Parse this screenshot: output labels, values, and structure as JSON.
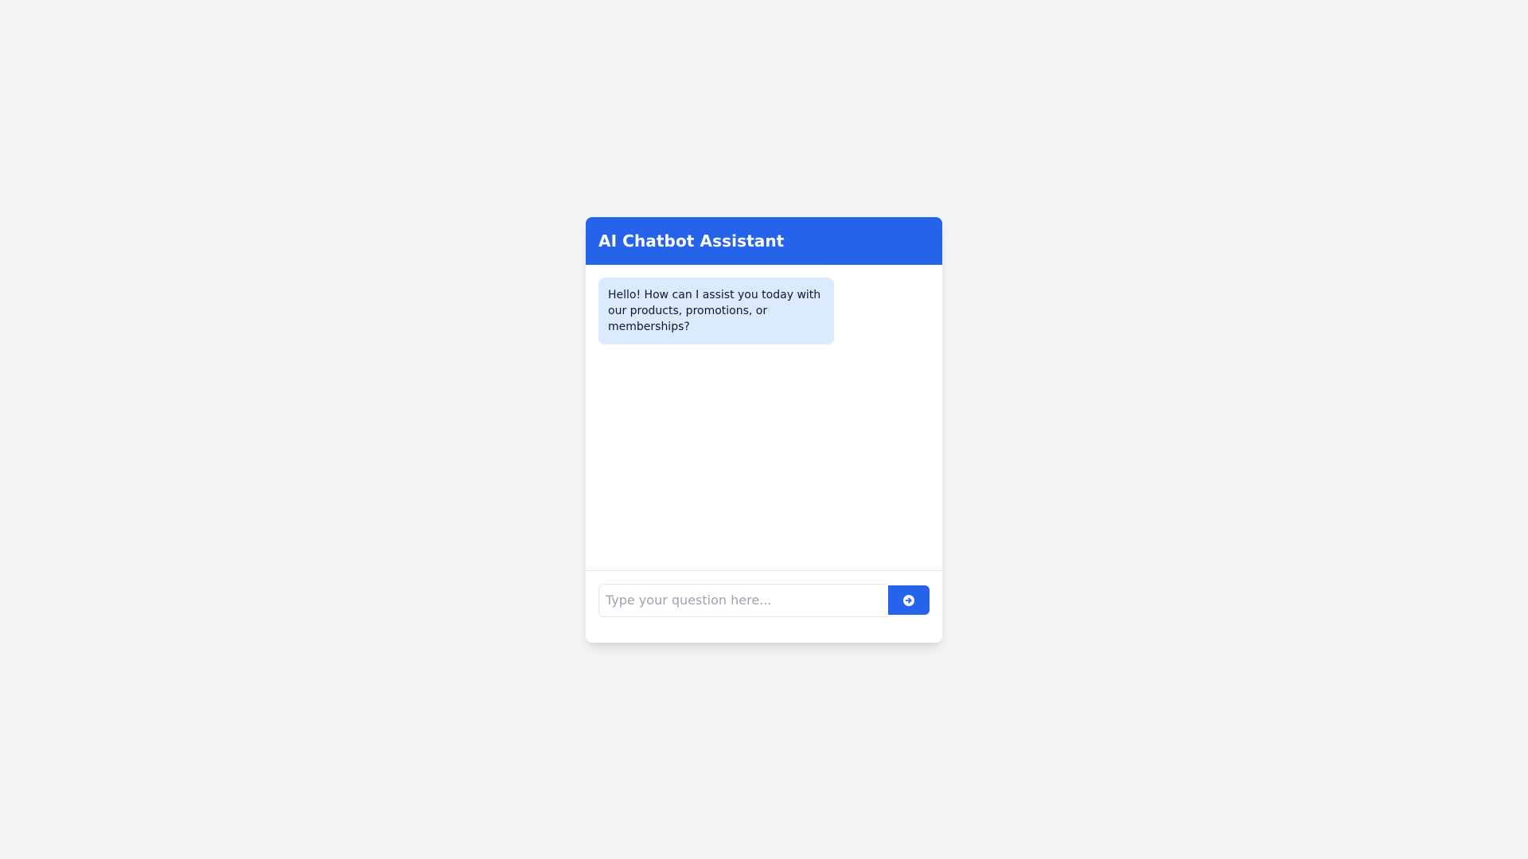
{
  "header": {
    "title": "AI Chatbot Assistant"
  },
  "messages": [
    {
      "sender": "bot",
      "text": "Hello! How can I assist you today with our products, promotions, or memberships?"
    }
  ],
  "input": {
    "placeholder": "Type your question here...",
    "value": ""
  },
  "send_button": {
    "icon": "arrow-circle-right-icon"
  },
  "colors": {
    "accent": "#2563eb",
    "bot_bubble": "#dbeafe",
    "page_background": "#f3f4f6"
  }
}
